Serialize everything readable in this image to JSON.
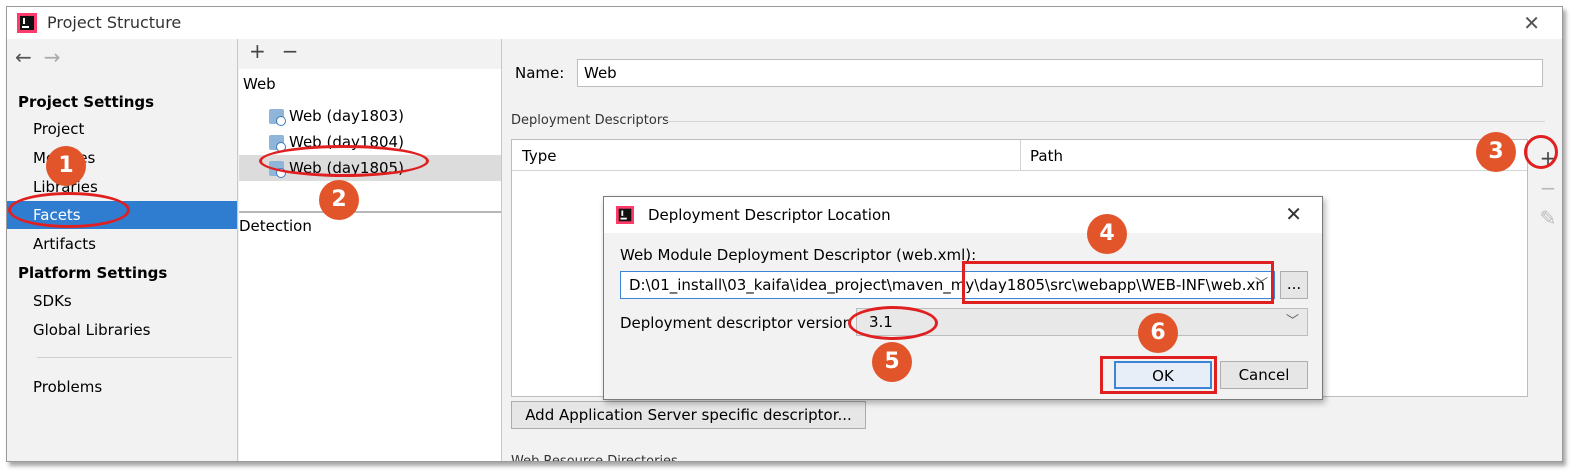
{
  "window": {
    "title": "Project Structure"
  },
  "nav": {
    "project_settings_header": "Project Settings",
    "project_items": [
      "Project",
      "Modules",
      "Libraries",
      "Facets",
      "Artifacts"
    ],
    "selected_item": "Facets",
    "platform_settings_header": "Platform Settings",
    "platform_items": [
      "SDKs",
      "Global Libraries"
    ],
    "problems": "Problems"
  },
  "tree": {
    "toolbar_add": "+",
    "toolbar_remove": "−",
    "root": "Web",
    "items": [
      "Web (day1803)",
      "Web (day1804)",
      "Web (day1805)"
    ],
    "selected_item": "Web (day1805)",
    "detection": "Detection"
  },
  "facet": {
    "name_label": "Name:",
    "name_value": "Web",
    "deployment_descriptors_label": "Deployment Descriptors",
    "table_columns": [
      "Type",
      "Path"
    ],
    "add_server_button": "Add Application Server specific descriptor...",
    "web_resource_label": "Web Resource Directories"
  },
  "dialog": {
    "title": "Deployment Descriptor Location",
    "descriptor_label": "Web Module Deployment Descriptor (web.xml):",
    "descriptor_path": "D:\\01_install\\03_kaifa\\idea_project\\maven_my\\day1805\\src\\webapp\\WEB-INF\\web.xn",
    "browse_button": "...",
    "version_label": "Deployment descriptor version",
    "version_value": "3.1",
    "ok_button": "OK",
    "cancel_button": "Cancel"
  },
  "annotations": {
    "steps": [
      "1",
      "2",
      "3",
      "4",
      "5",
      "6"
    ],
    "color": "#e02020",
    "badge_color": "#e2542a"
  },
  "icons": [
    "intellij-app-icon",
    "back-arrow-icon",
    "forward-arrow-icon",
    "add-icon",
    "remove-icon",
    "edit-pencil-icon",
    "web-facet-icon",
    "close-icon",
    "dropdown-arrow-icon"
  ]
}
